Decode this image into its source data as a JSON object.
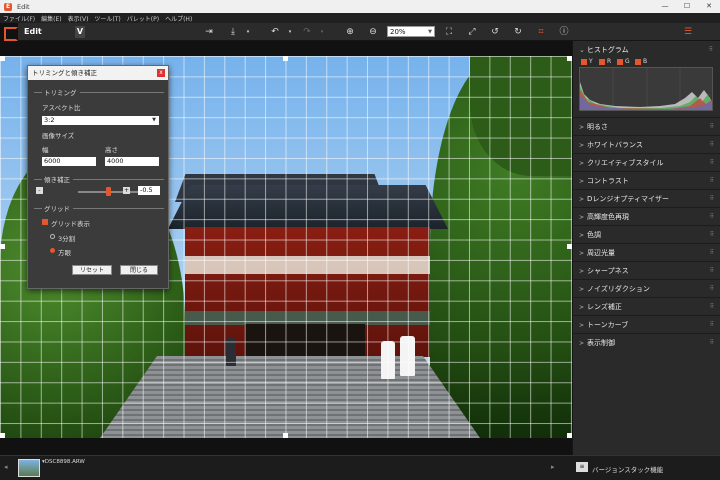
{
  "window": {
    "app_icon": "E",
    "title": "Edit",
    "minimize": "—",
    "maximize": "☐",
    "close": "✕"
  },
  "menu": [
    "ファイル(F)",
    "編集(E)",
    "表示(V)",
    "ツール(T)",
    "パレット(P)",
    "ヘルプ(H)"
  ],
  "toolbar": {
    "mode": "Edit",
    "v_mark": "V",
    "zoom": "20%",
    "icons": [
      "export-icon",
      "download-icon",
      "undo-icon",
      "redo-icon",
      "zoom-in-icon",
      "zoom-out-icon",
      "fit-icon",
      "fullscreen-icon",
      "rotate-left-icon",
      "rotate-right-icon",
      "crop-icon",
      "info-icon",
      "adjust-panel-icon"
    ]
  },
  "dialog": {
    "title": "トリミングと傾き補正",
    "close": "x",
    "trimming_section": "トリミング",
    "aspect_label": "アスペクト比",
    "aspect_value": "3:2",
    "image_size_label": "画像サイズ",
    "width_label": "幅",
    "height_label": "高さ",
    "width_value": "6000",
    "height_value": "4000",
    "tilt_section": "傾き補正",
    "tilt_minus": "-",
    "tilt_plus": "+",
    "tilt_value": "-0.5",
    "grid_section": "グリッド",
    "grid_show_label": "グリッド表示",
    "grid_thirds": "3分割",
    "grid_squares": "方眼",
    "reset_button": "リセット",
    "close_button": "閉じる"
  },
  "right_panel": {
    "histogram_title": "ヒストグラム",
    "channels": [
      "Y",
      "R",
      "G",
      "B"
    ],
    "sections": [
      "明るさ",
      "ホワイトバランス",
      "クリエイティブスタイル",
      "コントラスト",
      "Dレンジオプティマイザー",
      "高輝度色再現",
      "色調",
      "周辺光量",
      "シャープネス",
      "ノイズリダクション",
      "レンズ補正",
      "トーンカーブ",
      "表示制御"
    ]
  },
  "filmstrip": {
    "file_name": "▾DSC8898.ARW"
  },
  "version_stack": {
    "label": "バージョンスタック機能"
  }
}
